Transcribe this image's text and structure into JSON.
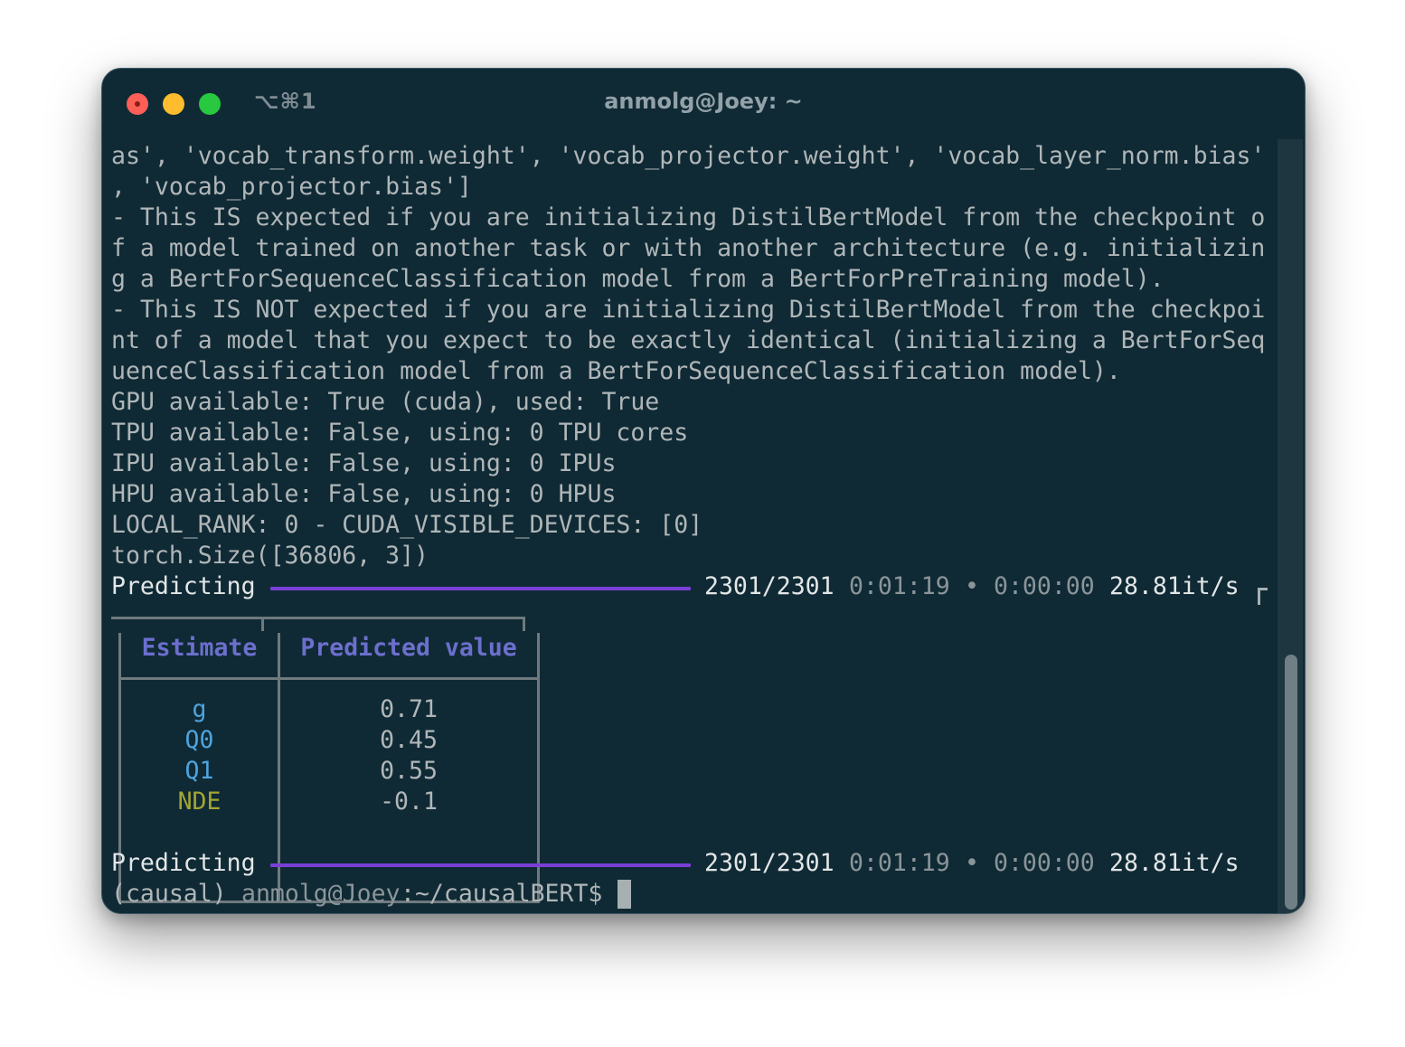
{
  "window": {
    "shortcut": "⌥⌘1",
    "title": "anmolg@Joey: ~"
  },
  "terminal": {
    "output_lines": [
      "as', 'vocab_transform.weight', 'vocab_projector.weight', 'vocab_layer_norm.bias'",
      ", 'vocab_projector.bias']",
      "- This IS expected if you are initializing DistilBertModel from the checkpoint o",
      "f a model trained on another task or with another architecture (e.g. initializin",
      "g a BertForSequenceClassification model from a BertForPreTraining model).",
      "- This IS NOT expected if you are initializing DistilBertModel from the checkpoi",
      "nt of a model that you expect to be exactly identical (initializing a BertForSeq",
      "uenceClassification model from a BertForSequenceClassification model).",
      "GPU available: True (cuda), used: True",
      "TPU available: False, using: 0 TPU cores",
      "IPU available: False, using: 0 IPUs",
      "HPU available: False, using: 0 HPUs",
      "LOCAL_RANK: 0 - CUDA_VISIBLE_DEVICES: [0]",
      "torch.Size([36806, 3])"
    ],
    "progress_1": {
      "label": "Predicting",
      "count": "2301/2301",
      "elapsed": "0:01:19",
      "separator": "•",
      "remaining": "0:00:00",
      "rate": "28.81it/s",
      "fraction": 1.0
    },
    "table": {
      "headers": [
        "Estimate",
        "Predicted value"
      ],
      "rows": [
        {
          "estimate": "g",
          "value": "0.71"
        },
        {
          "estimate": "Q0",
          "value": "0.45"
        },
        {
          "estimate": "Q1",
          "value": "0.55"
        },
        {
          "estimate": "NDE",
          "value": "-0.1"
        }
      ]
    },
    "progress_2": {
      "label": "Predicting",
      "count": "2301/2301",
      "elapsed": "0:01:19",
      "separator": "•",
      "remaining": "0:00:00",
      "rate": "28.81it/s",
      "fraction": 1.0
    },
    "prompt": {
      "env": "(causal)",
      "user_host": "anmolg@Joey",
      "path": ":~/causalBERT$"
    }
  },
  "colors": {
    "background": "#0f2a35",
    "text": "#b0b6b8",
    "progress_bar": "#7a3fd6",
    "table_header": "#6c6fcc",
    "estimate_blue": "#4ea4de",
    "estimate_olive": "#a5a631"
  }
}
